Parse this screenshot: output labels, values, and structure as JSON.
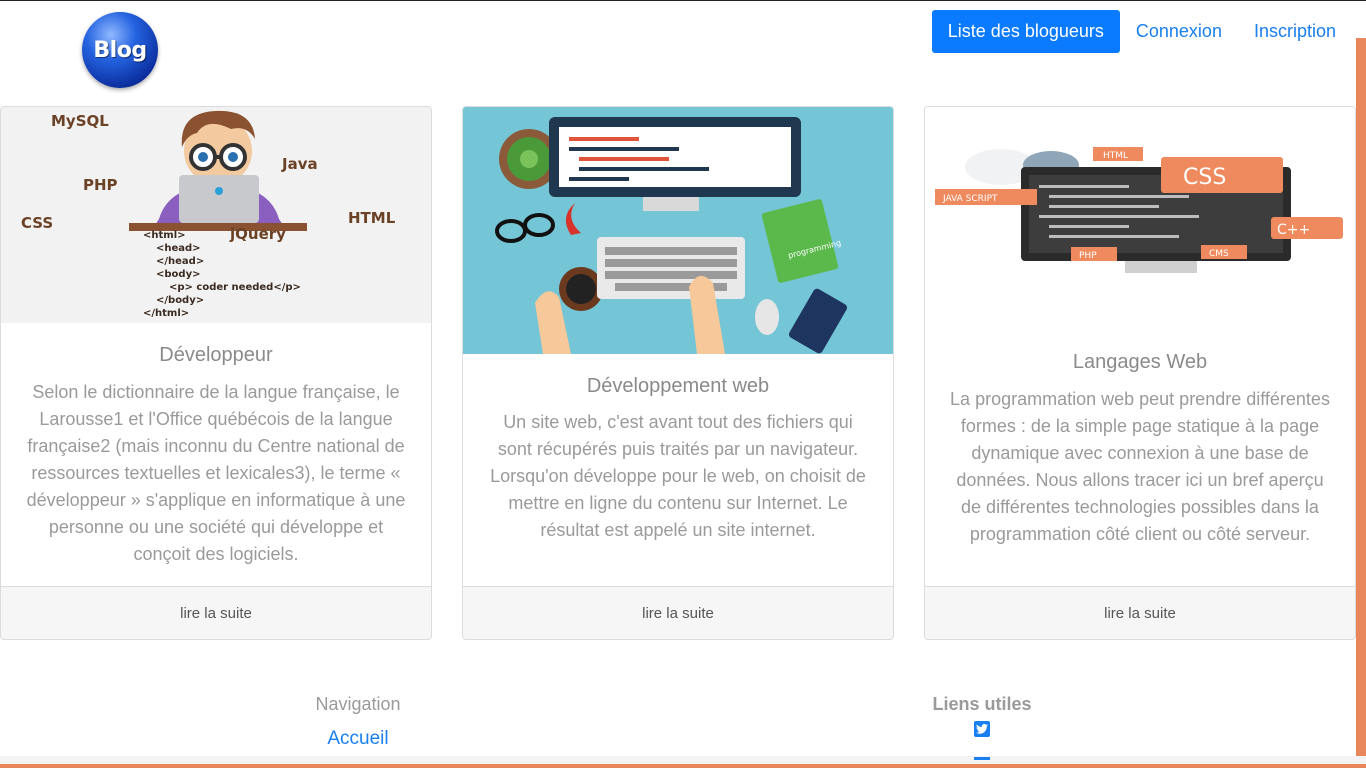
{
  "header": {
    "logo_text": "Blog",
    "nav": {
      "bloggers": "Liste des blogueurs",
      "login": "Connexion",
      "signup": "Inscription"
    }
  },
  "cards": [
    {
      "title": "Développeur",
      "text": "Selon le dictionnaire de la langue française, le Larousse1 et l'Office québécois de la langue française2 (mais inconnu du Centre national de ressources textuelles et lexicales3), le terme « développeur » s'applique en informatique à une personne ou une société qui développe et conçoit des logiciels.",
      "link": "lire la suite",
      "illustration": {
        "labels": [
          "MySQL",
          "Java",
          "PHP",
          "CSS",
          "HTML",
          "jQuery"
        ],
        "code": [
          "<html>",
          "<head>",
          "</head>",
          "<body>",
          "<p>  coder needed</p>",
          "</body>",
          "</html>"
        ]
      }
    },
    {
      "title": "Développement web",
      "text": "Un site web, c'est avant tout des fichiers qui sont récupérés puis traités par un navigateur. Lorsqu'on développe pour le web, on choisit de mettre en ligne du contenu sur Internet. Le résultat est appelé un site internet.",
      "link": "lire la suite",
      "illustration": {
        "book_label": "programming"
      }
    },
    {
      "title": "Langages Web",
      "text": "La programmation web peut prendre différentes formes : de la simple page statique à la page dynamique avec connexion à une base de données. Nous allons tracer ici un bref aperçu de différentes technologies possibles dans la programmation côté client ou côté serveur.",
      "link": "lire la suite",
      "illustration": {
        "labels": [
          "HTML",
          "CSS",
          "JAVA SCRIPT",
          "C++",
          "PHP",
          "CMS"
        ]
      }
    }
  ],
  "footer": {
    "nav_title": "Navigation",
    "nav_home": "Accueil",
    "links_title": "Liens utiles"
  },
  "colors": {
    "primary": "#0a7bff",
    "link": "#1a7ff0",
    "accent": "#e8875b"
  }
}
